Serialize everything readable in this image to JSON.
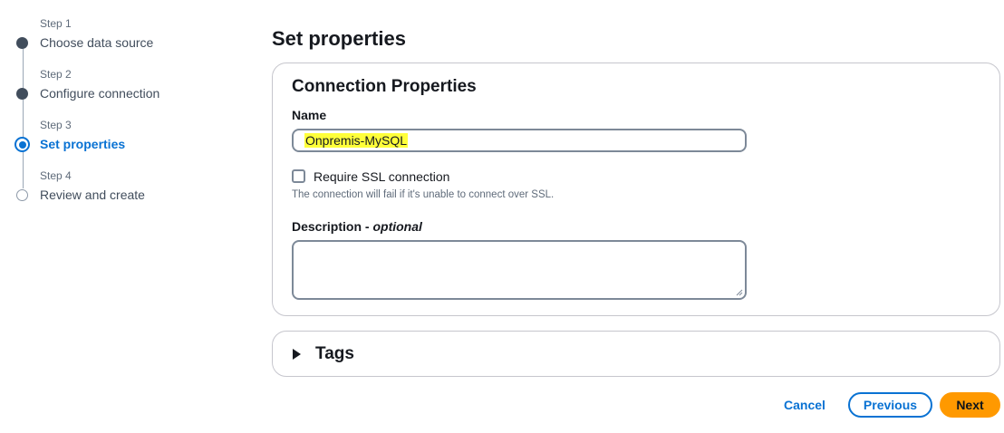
{
  "wizard": {
    "steps": [
      {
        "label": "Step 1",
        "title": "Choose data source",
        "state": "completed"
      },
      {
        "label": "Step 2",
        "title": "Configure connection",
        "state": "completed"
      },
      {
        "label": "Step 3",
        "title": "Set properties",
        "state": "current"
      },
      {
        "label": "Step 4",
        "title": "Review and create",
        "state": "upcoming"
      }
    ]
  },
  "page": {
    "title": "Set properties"
  },
  "connection_properties": {
    "heading": "Connection Properties",
    "name_label": "Name",
    "name_value": "Onpremis-MySQL",
    "ssl_checkbox_label": "Require SSL connection",
    "ssl_checked": false,
    "ssl_hint": "The connection will fail if it's unable to connect over SSL.",
    "description_label": "Description - ",
    "description_optional": "optional",
    "description_value": ""
  },
  "tags": {
    "title": "Tags",
    "expanded": false
  },
  "footer": {
    "cancel_label": "Cancel",
    "previous_label": "Previous",
    "next_label": "Next"
  },
  "colors": {
    "accent": "#0972d3",
    "primary_button": "#ff9900",
    "highlight": "#ffff3a"
  }
}
